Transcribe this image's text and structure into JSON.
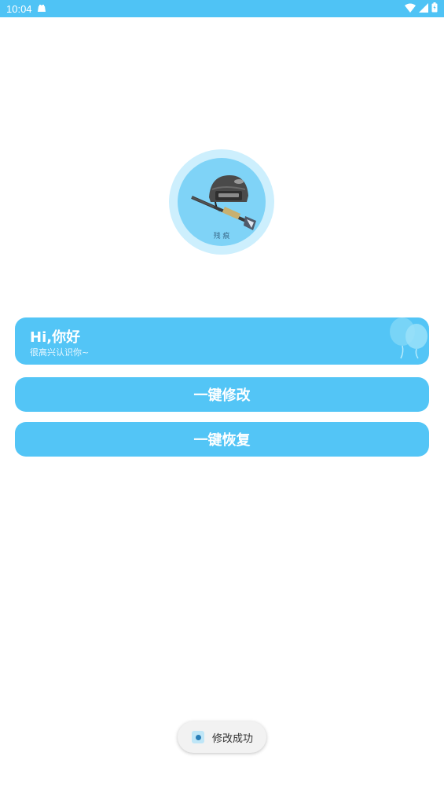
{
  "status_bar": {
    "time": "10:04",
    "icons": [
      "notification-icon",
      "wifi-icon",
      "signal-icon",
      "battery-icon"
    ]
  },
  "avatar": {
    "caption": "残 痕"
  },
  "greeting": {
    "title": "Hi,你好",
    "subtitle": "很高兴认识你~"
  },
  "buttons": {
    "modify_label": "一键修改",
    "restore_label": "一键恢复"
  },
  "toast": {
    "message": "修改成功"
  },
  "colors": {
    "accent": "#53c5f6",
    "status_bar": "#4fc3f5",
    "background": "#ffffff"
  }
}
